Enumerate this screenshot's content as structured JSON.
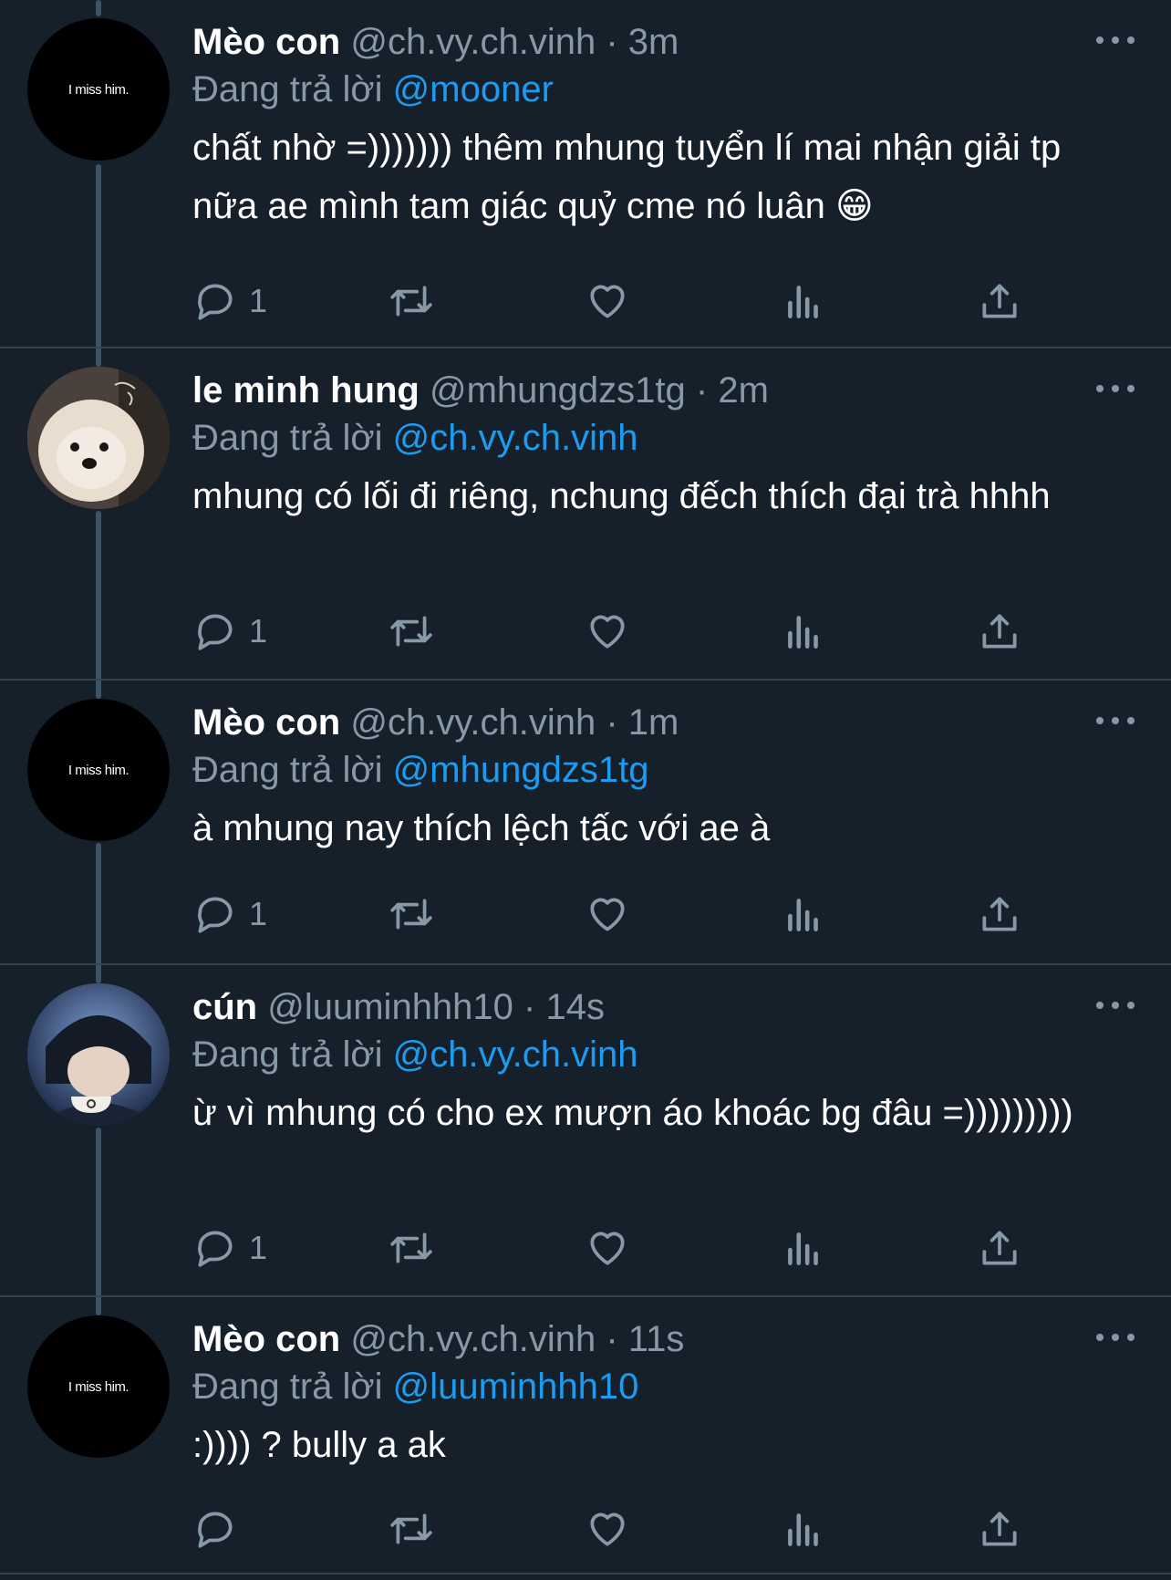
{
  "reply_prefix": "Đang trả lời",
  "colors": {
    "background": "#15202b",
    "accent": "#1d9bf0",
    "secondary": "#8899a6"
  },
  "tweets": [
    {
      "name": "Mèo con",
      "handle": "@ch.vy.ch.vinh",
      "time": "3m",
      "reply_to": "@mooner",
      "text": "chất nhờ =))))))) thêm mhung tuyển lí mai nhận giải tp nữa ae mình tam giác quỷ cme nó luân 😁",
      "reply_count": "1",
      "avatar_text": "I miss him."
    },
    {
      "name": "le minh hung",
      "handle": "@mhungdzs1tg",
      "time": "2m",
      "reply_to": "@ch.vy.ch.vinh",
      "text": "mhung có lối đi riêng, nchung đếch thích đại trà hhhh",
      "reply_count": "1"
    },
    {
      "name": "Mèo con",
      "handle": "@ch.vy.ch.vinh",
      "time": "1m",
      "reply_to": "@mhungdzs1tg",
      "text": "à mhung nay thích lệch tấc với ae à",
      "reply_count": "1",
      "avatar_text": "I miss him."
    },
    {
      "name": "cún",
      "handle": "@luuminhhh10",
      "time": "14s",
      "reply_to": "@ch.vy.ch.vinh",
      "text": "ừ vì mhung có cho ex mượn áo khoác bg đâu =)))))))))",
      "reply_count": "1"
    },
    {
      "name": "Mèo con",
      "handle": "@ch.vy.ch.vinh",
      "time": "11s",
      "reply_to": "@luuminhhh10",
      "text": ":)))) ? bully a ak",
      "reply_count": "",
      "avatar_text": "I miss him."
    }
  ]
}
